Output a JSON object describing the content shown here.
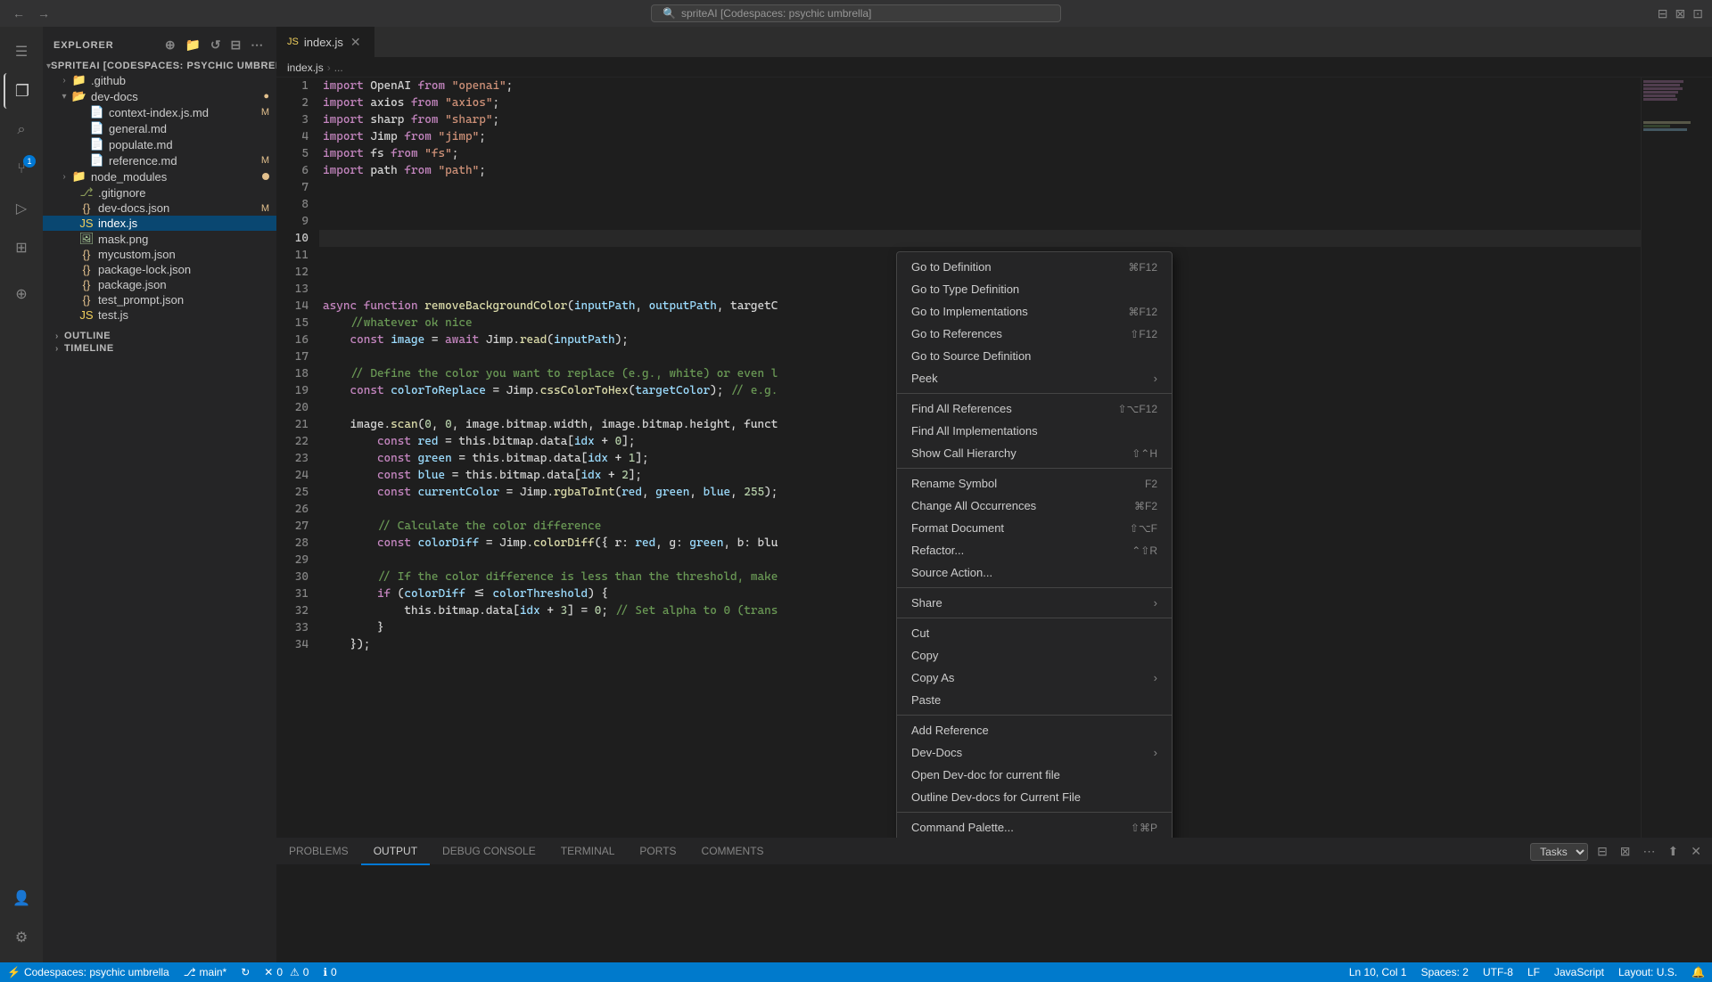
{
  "titleBar": {
    "searchPlaceholder": "spriteAI [Codespaces: psychic umbrella]",
    "navBack": "←",
    "navForward": "→"
  },
  "activityBar": {
    "icons": [
      {
        "name": "menu-icon",
        "symbol": "☰",
        "active": false
      },
      {
        "name": "explorer-icon",
        "symbol": "⎘",
        "active": true
      },
      {
        "name": "search-icon",
        "symbol": "🔍",
        "active": false
      },
      {
        "name": "source-control-icon",
        "symbol": "⑂",
        "active": false,
        "badge": "1"
      },
      {
        "name": "run-icon",
        "symbol": "▷",
        "active": false
      },
      {
        "name": "extensions-icon",
        "symbol": "⊞",
        "active": false
      },
      {
        "name": "remote-icon",
        "symbol": "⊕",
        "active": false
      }
    ],
    "bottomIcons": [
      {
        "name": "accounts-icon",
        "symbol": "👤"
      },
      {
        "name": "settings-icon",
        "symbol": "⚙"
      }
    ]
  },
  "sidebar": {
    "title": "EXPLORER",
    "rootFolder": "SPRITEAI [CODESPACES: PSYCHIC UMBRELLA]",
    "items": [
      {
        "label": ".github",
        "type": "folder",
        "indent": 1,
        "collapsed": true
      },
      {
        "label": "dev-docs",
        "type": "folder",
        "indent": 1,
        "collapsed": false,
        "modified": true
      },
      {
        "label": "context-index.js.md",
        "type": "file",
        "indent": 2,
        "icon": "md",
        "badge": "M"
      },
      {
        "label": "general.md",
        "type": "file",
        "indent": 2,
        "icon": "md"
      },
      {
        "label": "populate.md",
        "type": "file",
        "indent": 2,
        "icon": "md"
      },
      {
        "label": "reference.md",
        "type": "file",
        "indent": 2,
        "icon": "md",
        "badge": "M"
      },
      {
        "label": "node_modules",
        "type": "folder",
        "indent": 1,
        "collapsed": true,
        "dot": true
      },
      {
        "label": ".gitignore",
        "type": "file",
        "indent": 1,
        "icon": "git"
      },
      {
        "label": "dev-docs.json",
        "type": "file",
        "indent": 1,
        "icon": "json",
        "badge": "M"
      },
      {
        "label": "index.js",
        "type": "file",
        "indent": 1,
        "icon": "js",
        "selected": true
      },
      {
        "label": "mask.png",
        "type": "file",
        "indent": 1,
        "icon": "img"
      },
      {
        "label": "mycustom.json",
        "type": "file",
        "indent": 1,
        "icon": "json"
      },
      {
        "label": "package-lock.json",
        "type": "file",
        "indent": 1,
        "icon": "json"
      },
      {
        "label": "package.json",
        "type": "file",
        "indent": 1,
        "icon": "json"
      },
      {
        "label": "test_prompt.json",
        "type": "file",
        "indent": 1,
        "icon": "json"
      },
      {
        "label": "test.js",
        "type": "file",
        "indent": 1,
        "icon": "js"
      }
    ],
    "sections": [
      {
        "label": "OUTLINE",
        "collapsed": true
      },
      {
        "label": "TIMELINE",
        "collapsed": true
      }
    ]
  },
  "tabs": [
    {
      "label": "index.js",
      "active": true,
      "icon": "js"
    }
  ],
  "breadcrumb": {
    "parts": [
      "index.js",
      "›",
      "..."
    ]
  },
  "codeLines": [
    {
      "num": 1,
      "content": "import OpenAI from 'openai';",
      "tokens": [
        {
          "t": "import",
          "c": "kw"
        },
        {
          "t": " OpenAI ",
          "c": ""
        },
        {
          "t": "from",
          "c": "kw"
        },
        {
          "t": " ",
          "c": ""
        },
        {
          "t": "'openai'",
          "c": "str"
        },
        {
          "t": ";",
          "c": ""
        }
      ]
    },
    {
      "num": 2,
      "content": "import axios from 'axios';"
    },
    {
      "num": 3,
      "content": "import sharp from 'sharp';"
    },
    {
      "num": 4,
      "content": "import Jimp from 'jimp';"
    },
    {
      "num": 5,
      "content": "import fs from 'fs';"
    },
    {
      "num": 6,
      "content": "import path from 'path';"
    },
    {
      "num": 7,
      "content": ""
    },
    {
      "num": 8,
      "content": ""
    },
    {
      "num": 9,
      "content": ""
    },
    {
      "num": 10,
      "content": "",
      "current": true
    },
    {
      "num": 11,
      "content": ""
    },
    {
      "num": 12,
      "content": ""
    },
    {
      "num": 13,
      "content": ""
    },
    {
      "num": 14,
      "content": "async function removeBackgroundColor(inputPath, outputPath, targeto"
    },
    {
      "num": 15,
      "content": "    //whatever ok nice"
    },
    {
      "num": 16,
      "content": "    const image = await Jimp.read(inputPath);"
    },
    {
      "num": 17,
      "content": ""
    },
    {
      "num": 18,
      "content": "    // Define the color you want to replace (e.g., white) or even l"
    },
    {
      "num": 19,
      "content": "    const colorToReplace = Jimp.cssColorToHex(targetColor); // e.g."
    },
    {
      "num": 20,
      "content": ""
    },
    {
      "num": 21,
      "content": "    image.scan(0, 0, image.bitmap.width, image.bitmap.height, funct"
    },
    {
      "num": 22,
      "content": "        const red = this.bitmap.data[idx + 0];"
    },
    {
      "num": 23,
      "content": "        const green = this.bitmap.data[idx + 1];"
    },
    {
      "num": 24,
      "content": "        const blue = this.bitmap.data[idx + 2];"
    },
    {
      "num": 25,
      "content": "        const currentColor = Jimp.rgbaToInt(red, green, blue, 255);"
    },
    {
      "num": 26,
      "content": ""
    },
    {
      "num": 27,
      "content": "        // Calculate the color difference"
    },
    {
      "num": 28,
      "content": "        const colorDiff = Jimp.colorDiff({ r: red, g: green, b: blu"
    },
    {
      "num": 29,
      "content": ""
    },
    {
      "num": 30,
      "content": "        // If the color difference is less than the threshold, make"
    },
    {
      "num": 31,
      "content": "        if (colorDiff <= colorThreshold) {"
    },
    {
      "num": 32,
      "content": "            this.bitmap.data[idx + 3] = 0; // Set alpha to 0 (trans"
    },
    {
      "num": 33,
      "content": "        }"
    },
    {
      "num": 34,
      "content": "    });"
    }
  ],
  "contextMenu": {
    "items": [
      {
        "label": "Go to Definition",
        "shortcut": "⌘F12",
        "type": "item"
      },
      {
        "label": "Go to Type Definition",
        "type": "item"
      },
      {
        "label": "Go to Implementations",
        "shortcut": "⌘F12",
        "type": "item"
      },
      {
        "label": "Go to References",
        "shortcut": "⇧F12",
        "type": "item"
      },
      {
        "label": "Go to Source Definition",
        "type": "item"
      },
      {
        "label": "Peek",
        "type": "submenu"
      },
      {
        "type": "separator"
      },
      {
        "label": "Find All References",
        "shortcut": "⇧⌥F12",
        "type": "item"
      },
      {
        "label": "Find All Implementations",
        "type": "item"
      },
      {
        "label": "Show Call Hierarchy",
        "shortcut": "⇧⌃H",
        "type": "item"
      },
      {
        "type": "separator"
      },
      {
        "label": "Rename Symbol",
        "shortcut": "F2",
        "type": "item"
      },
      {
        "label": "Change All Occurrences",
        "shortcut": "⌘F2",
        "type": "item"
      },
      {
        "label": "Format Document",
        "shortcut": "⇧⌥F",
        "type": "item"
      },
      {
        "label": "Refactor...",
        "shortcut": "⌃⇧R",
        "type": "item"
      },
      {
        "label": "Source Action...",
        "type": "item"
      },
      {
        "type": "separator"
      },
      {
        "label": "Share",
        "type": "submenu"
      },
      {
        "type": "separator"
      },
      {
        "label": "Cut",
        "type": "item"
      },
      {
        "label": "Copy",
        "type": "item"
      },
      {
        "label": "Copy As",
        "type": "submenu"
      },
      {
        "label": "Paste",
        "type": "item"
      },
      {
        "type": "separator"
      },
      {
        "label": "Add Reference",
        "type": "item"
      },
      {
        "label": "Dev-Docs",
        "type": "submenu"
      },
      {
        "label": "Open Dev-doc for current file",
        "type": "item"
      },
      {
        "label": "Outline Dev-docs for Current File",
        "type": "item"
      },
      {
        "type": "separator"
      },
      {
        "label": "Command Palette...",
        "shortcut": "⇧⌘P",
        "type": "item"
      }
    ]
  },
  "panel": {
    "tabs": [
      "PROBLEMS",
      "OUTPUT",
      "DEBUG CONSOLE",
      "TERMINAL",
      "PORTS",
      "COMMENTS"
    ],
    "activeTab": "OUTPUT",
    "taskDropdown": "Tasks"
  },
  "statusBar": {
    "left": [
      {
        "icon": "remote-status-icon",
        "label": "Codespaces: psychic umbrella"
      },
      {
        "icon": "branch-icon",
        "label": "main*"
      },
      {
        "icon": "sync-icon",
        "label": ""
      },
      {
        "icon": "error-icon",
        "label": "0"
      },
      {
        "icon": "warning-icon",
        "label": "0"
      },
      {
        "icon": "info-icon",
        "label": "0"
      }
    ],
    "right": [
      {
        "label": "Ln 10, Col 1"
      },
      {
        "label": "Spaces: 2"
      },
      {
        "label": "UTF-8"
      },
      {
        "label": "LF"
      },
      {
        "label": "JavaScript"
      },
      {
        "label": "Layout: U.S."
      },
      {
        "label": ""
      }
    ]
  }
}
